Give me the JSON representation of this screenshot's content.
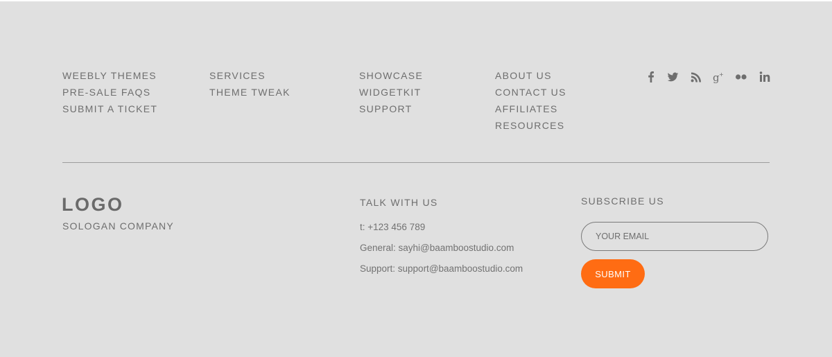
{
  "nav": {
    "col1": [
      "WEEBLY THEMES",
      "PRE-SALE FAQS",
      "SUBMIT A TICKET"
    ],
    "col2": [
      "SERVICES",
      "THEME TWEAK"
    ],
    "col3": [
      "SHOWCASE",
      "WIDGETKIT",
      "SUPPORT"
    ],
    "col4": [
      "ABOUT US",
      "CONTACT US",
      "AFFILIATES",
      "RESOURCES"
    ]
  },
  "social": {
    "icons": [
      "facebook-icon",
      "twitter-icon",
      "rss-icon",
      "google-plus-icon",
      "flickr-icon",
      "linkedin-icon"
    ]
  },
  "brand": {
    "logo": "LOGO",
    "slogan": "SOLOGAN COMPANY"
  },
  "talk": {
    "heading": "TALK WITH US",
    "phone": "t: +123 456 789",
    "general": "General: sayhi@baamboostudio.com",
    "support": "Support: support@baamboostudio.com"
  },
  "subscribe": {
    "heading": "SUBSCRIBE US",
    "placeholder": "YOUR EMAIL",
    "button": "SUBMIT"
  },
  "colors": {
    "background": "#e0e0e0",
    "text": "#6e6e6e",
    "accent": "#ff6c13",
    "divider": "#9d9d9d"
  }
}
